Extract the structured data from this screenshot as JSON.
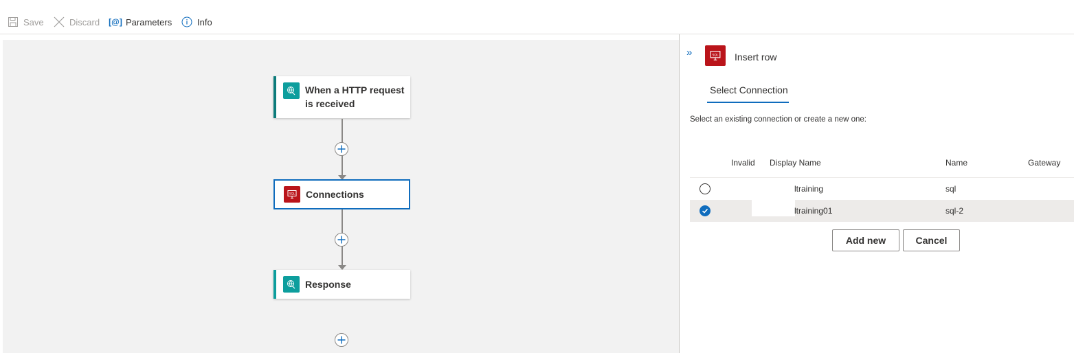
{
  "toolbar": {
    "save_label": "Save",
    "discard_label": "Discard",
    "parameters_label": "Parameters",
    "info_label": "Info"
  },
  "workflow": {
    "steps": [
      {
        "line1": "When a HTTP request",
        "line2": "is received",
        "icon": "globe-icon",
        "color": "#0d9e9d"
      },
      {
        "line1": "Connections",
        "icon": "sql-icon",
        "color": "#ba141a"
      },
      {
        "line1": "Response",
        "icon": "globe-icon",
        "color": "#0d9e9d"
      }
    ]
  },
  "panel": {
    "title": "Insert row",
    "tab": "Select Connection",
    "hint": "Select an existing connection or create a new one:",
    "columns": {
      "invalid": "Invalid",
      "display_name": "Display Name",
      "name": "Name",
      "gateway": "Gateway"
    },
    "rows": [
      {
        "display_name": "ltraining",
        "name": "sql",
        "selected": false
      },
      {
        "display_name": "ltraining01",
        "name": "sql-2",
        "selected": true
      }
    ],
    "add_new_label": "Add new",
    "cancel_label": "Cancel"
  },
  "colors": {
    "accent": "#0f6cbd",
    "sql_red": "#ba141a",
    "http_teal": "#0d9e9d"
  }
}
